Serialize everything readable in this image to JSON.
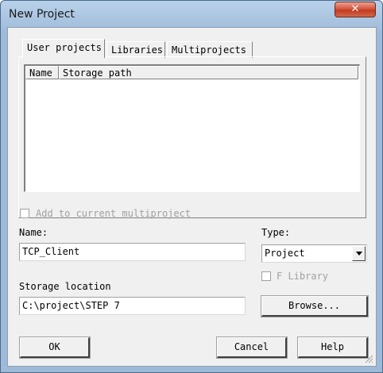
{
  "window": {
    "title": "New Project",
    "close_glyph": "✕"
  },
  "tabs": [
    {
      "label": "User projects",
      "active": true
    },
    {
      "label": "Libraries",
      "active": false
    },
    {
      "label": "Multiprojects",
      "active": false
    }
  ],
  "project_list": {
    "columns": [
      "Name",
      "Storage path"
    ],
    "rows": []
  },
  "add_to_multiproject": {
    "label": "Add to current multiproject",
    "checked": false,
    "enabled": false
  },
  "name": {
    "label": "Name:",
    "value": "TCP_Client"
  },
  "type": {
    "label": "Type:",
    "selected": "Project"
  },
  "f_library": {
    "label": "F Library",
    "checked": false,
    "enabled": false
  },
  "storage": {
    "label": "Storage location",
    "value": "C:\\project\\STEP 7"
  },
  "buttons": {
    "browse": "Browse...",
    "ok": "OK",
    "cancel": "Cancel",
    "help": "Help"
  },
  "icons": {
    "close": "close-icon",
    "combo": "chevron-down-icon",
    "grip": "resize-grip-icon"
  }
}
